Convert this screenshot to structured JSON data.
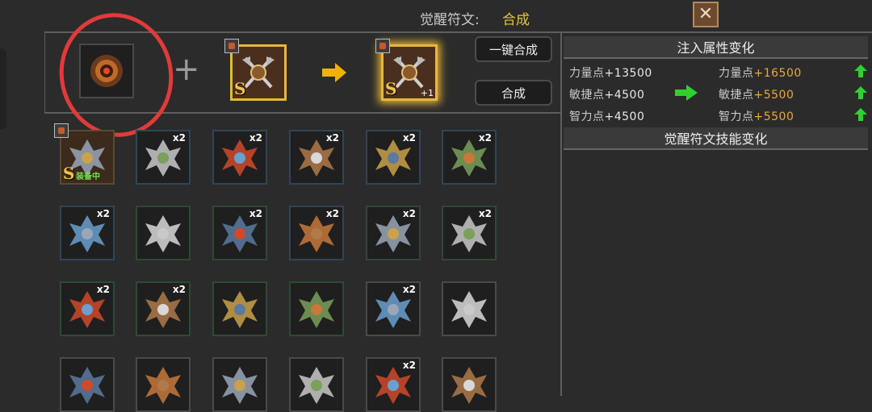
{
  "header": {
    "label": "觉醒符文:",
    "value": "合成",
    "close_icon": "close-x-icon"
  },
  "synth": {
    "plus_symbol": "+",
    "one_click_button": "一键合成",
    "synth_button": "合成",
    "result_level": "+1",
    "grade": "S"
  },
  "panel": {
    "attr_title": "注入属性变化",
    "skill_title": "觉醒符文技能变化",
    "stats": [
      {
        "name": "力量点",
        "old": "+13500",
        "new": "+16500"
      },
      {
        "name": "敏捷点",
        "old": "+4500",
        "new": "+5500"
      },
      {
        "name": "智力点",
        "old": "+4500",
        "new": "+5500"
      }
    ],
    "colors": {
      "up": "#2fd12f",
      "new_value": "#e7a93d"
    }
  },
  "inventory": {
    "equipped_label": "装备中",
    "count_label": "x2",
    "rows": [
      [
        "S",
        "x2",
        "x2",
        "x2",
        "x2",
        "x2"
      ],
      [
        "x2",
        "",
        "x2",
        "x2",
        "x2",
        "x2"
      ],
      [
        "x2",
        "x2",
        "",
        "",
        "x2",
        ""
      ],
      [
        "",
        "",
        "",
        "",
        "x2",
        ""
      ]
    ]
  }
}
